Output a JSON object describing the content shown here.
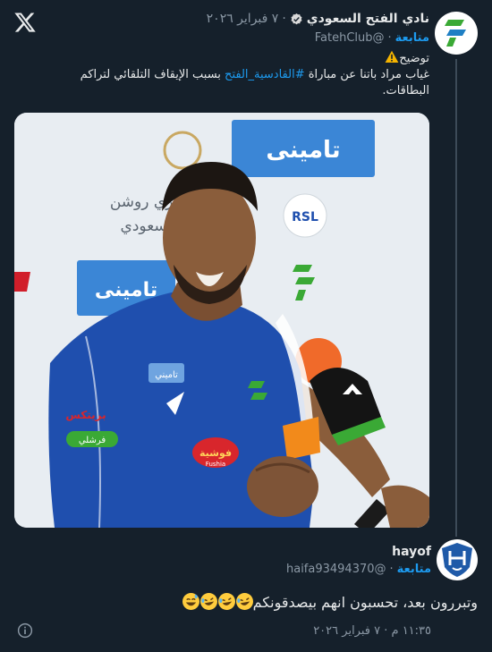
{
  "brand": {
    "x_icon": "x-logo-icon"
  },
  "tweet1": {
    "avatar_icon": "alfateh-logo-icon",
    "display_name": "نادي الفتح السعودي",
    "verified_icon": "verified-badge-icon",
    "separator": "·",
    "date": "٧ فبراير ٢٠٢٦",
    "handle": "@FatehClub",
    "follow_separator": "·",
    "follow_label": "متابعة",
    "text_heading": "توضيح",
    "text_heading_icon": "warning-icon",
    "text_before": "غياب مراد باتنا عن مباراة ",
    "hashtag": "#القادسية_الفتح",
    "text_after": " بسبب الإيقاف التلقائي لتراكم البطاقات.",
    "photo": {
      "sponsor_logo_1": "تامينى",
      "sponsor_logo_2": "تامينى",
      "banner_text_1": "دوري روشن",
      "banner_text_2": "السعودي",
      "rsl_badge": "RSL",
      "shirt_sponsor": "فوشية",
      "shirt_sponsor_latin": "Fushia",
      "shirt_label_left": "بريتكس",
      "shirt_label_left2": "فرشلي",
      "chest_badge": "تاميني"
    }
  },
  "tweet2": {
    "avatar_icon": "alhilal-logo-icon",
    "display_name": "hayof",
    "handle": "@haifa93494370",
    "follow_separator": "·",
    "follow_label": "متابعة",
    "text": "وتبررون بعد، تحسبون انهم بيصدقونكم",
    "emojis": [
      "rolling-laughing-emoji",
      "rolling-laughing-emoji",
      "rolling-laughing-emoji",
      "grinning-sweat-emoji"
    ],
    "timestamp": "١١:٣٥ م · ٧ فبراير ٢٠٢٦",
    "info_icon": "info-icon"
  },
  "colors": {
    "background": "#15202b",
    "link": "#1d9bf0",
    "muted": "#8b98a5",
    "kit_blue": "#1f4fae",
    "fateh_green": "#3aa935",
    "hilal_blue": "#1f5aa8"
  }
}
